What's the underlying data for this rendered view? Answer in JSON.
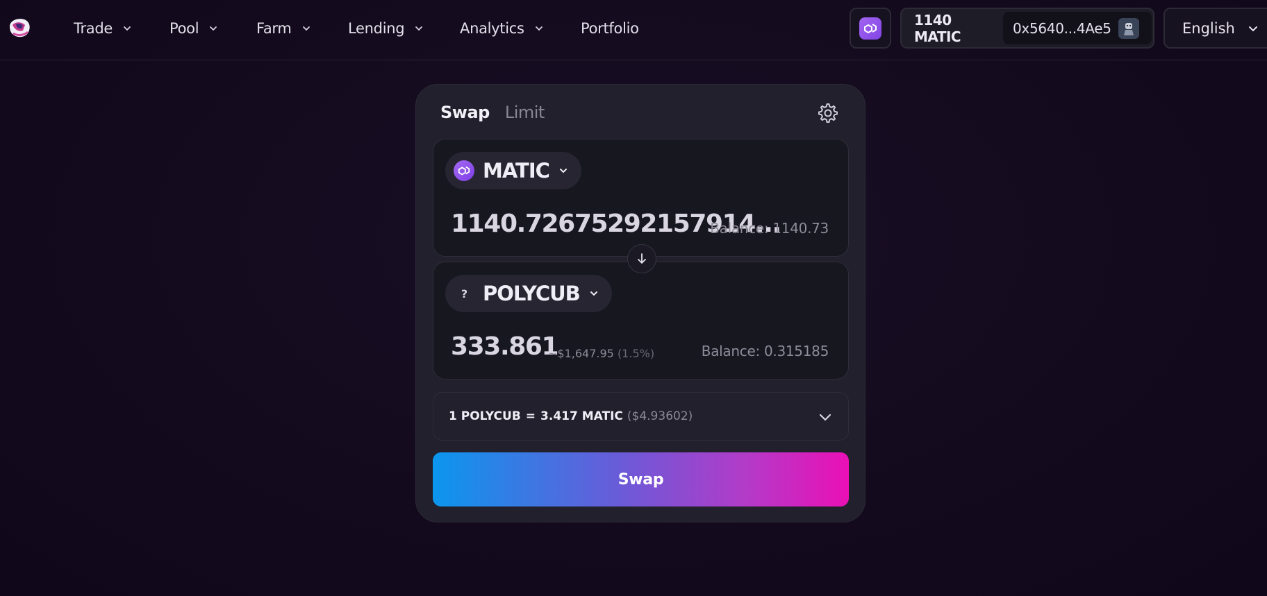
{
  "nav": {
    "items": [
      {
        "label": "Trade",
        "has_dropdown": true
      },
      {
        "label": "Pool",
        "has_dropdown": true
      },
      {
        "label": "Farm",
        "has_dropdown": true
      },
      {
        "label": "Lending",
        "has_dropdown": true
      },
      {
        "label": "Analytics",
        "has_dropdown": true
      },
      {
        "label": "Portfolio",
        "has_dropdown": false
      }
    ],
    "chain_icon": "polygon-icon",
    "wallet_balance": "1140 MATIC",
    "wallet_address": "0x5640...4Ae5",
    "language": "English"
  },
  "swap": {
    "tabs": [
      {
        "label": "Swap",
        "active": true
      },
      {
        "label": "Limit",
        "active": false
      }
    ],
    "from": {
      "token": "MATIC",
      "amount": "1140.72675292157914...",
      "balance": "Balance: 1140.73"
    },
    "to": {
      "token": "POLYCUB",
      "token_icon_text": "?",
      "amount": "333.861",
      "usd_value": "~$1,647.95",
      "price_impact": "(1.5%)",
      "balance": "Balance: 0.315185"
    },
    "rate": {
      "lhs": "1 POLYCUB",
      "eq": "=",
      "rhs": "3.417 MATIC",
      "usd": "($4.93602)"
    },
    "button_label": "Swap"
  },
  "colors": {
    "background": "#130a1d",
    "card": "#21202c",
    "panel": "#171720",
    "accent_start": "#0b96ee",
    "accent_end": "#ea10b6",
    "polygon_purple": "#8247e5"
  }
}
